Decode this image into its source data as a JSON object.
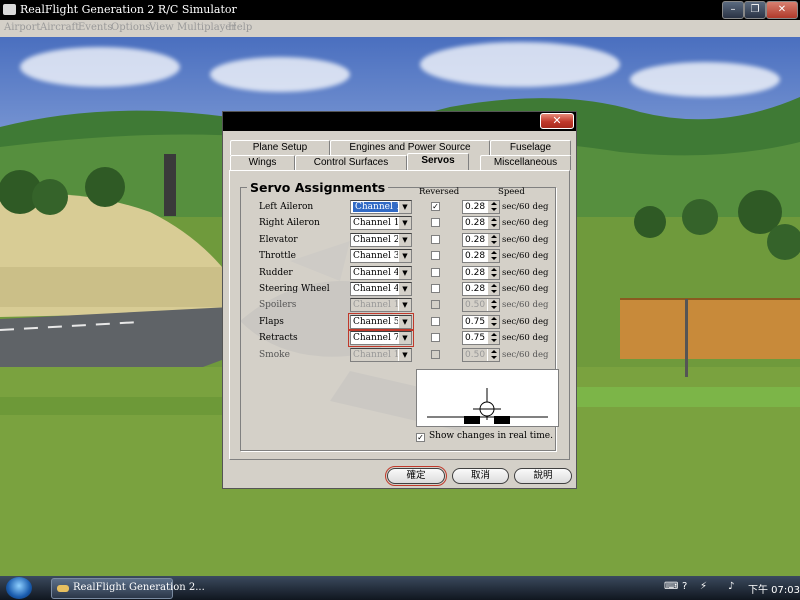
{
  "window": {
    "title": "RealFlight Generation 2 R/C Simulator"
  },
  "menu": [
    "Airport",
    "Aircraft",
    "Events",
    "Options",
    "View",
    "Multiplayer",
    "Help"
  ],
  "dialog": {
    "tabs_back": [
      "Plane Setup",
      "Engines and Power Source",
      "Fuselage"
    ],
    "tabs_front": [
      "Wings",
      "Control Surfaces",
      "Servos",
      "Miscellaneous"
    ],
    "active_tab": "Servos",
    "group_title": "Servo Assignments",
    "col_reversed": "Reversed",
    "col_speed": "Speed",
    "speed_unit": "sec/60 deg",
    "rows": [
      {
        "label": "Left Aileron",
        "channel": "Channel 1",
        "reversed": true,
        "speed": "0.28",
        "enabled": true
      },
      {
        "label": "Right Aileron",
        "channel": "Channel 1",
        "reversed": false,
        "speed": "0.28",
        "enabled": true
      },
      {
        "label": "Elevator",
        "channel": "Channel 2",
        "reversed": false,
        "speed": "0.28",
        "enabled": true
      },
      {
        "label": "Throttle",
        "channel": "Channel 3",
        "reversed": false,
        "speed": "0.28",
        "enabled": true
      },
      {
        "label": "Rudder",
        "channel": "Channel 4",
        "reversed": false,
        "speed": "0.28",
        "enabled": true
      },
      {
        "label": "Steering Wheel",
        "channel": "Channel 4",
        "reversed": false,
        "speed": "0.28",
        "enabled": true
      },
      {
        "label": "Spoilers",
        "channel": "Channel 1",
        "reversed": false,
        "speed": "0.50",
        "enabled": false
      },
      {
        "label": "Flaps",
        "channel": "Channel 5",
        "reversed": false,
        "speed": "0.75",
        "enabled": true
      },
      {
        "label": "Retracts",
        "channel": "Channel 7",
        "reversed": false,
        "speed": "0.75",
        "enabled": true
      },
      {
        "label": "Smoke",
        "channel": "Channel 1",
        "reversed": false,
        "speed": "0.50",
        "enabled": false
      }
    ],
    "realtime_label": "Show changes in real time.",
    "realtime_checked": true,
    "buttons": {
      "ok": "確定",
      "cancel": "取消",
      "help": "說明"
    }
  },
  "taskbar": {
    "item": "RealFlight Generation 2...",
    "clock": "下午 07:03"
  },
  "colors": {
    "selection": "#316ac5",
    "dialog_bg": "#d4d0c8",
    "close_red": "#c0392b",
    "title_black": "#000000"
  }
}
